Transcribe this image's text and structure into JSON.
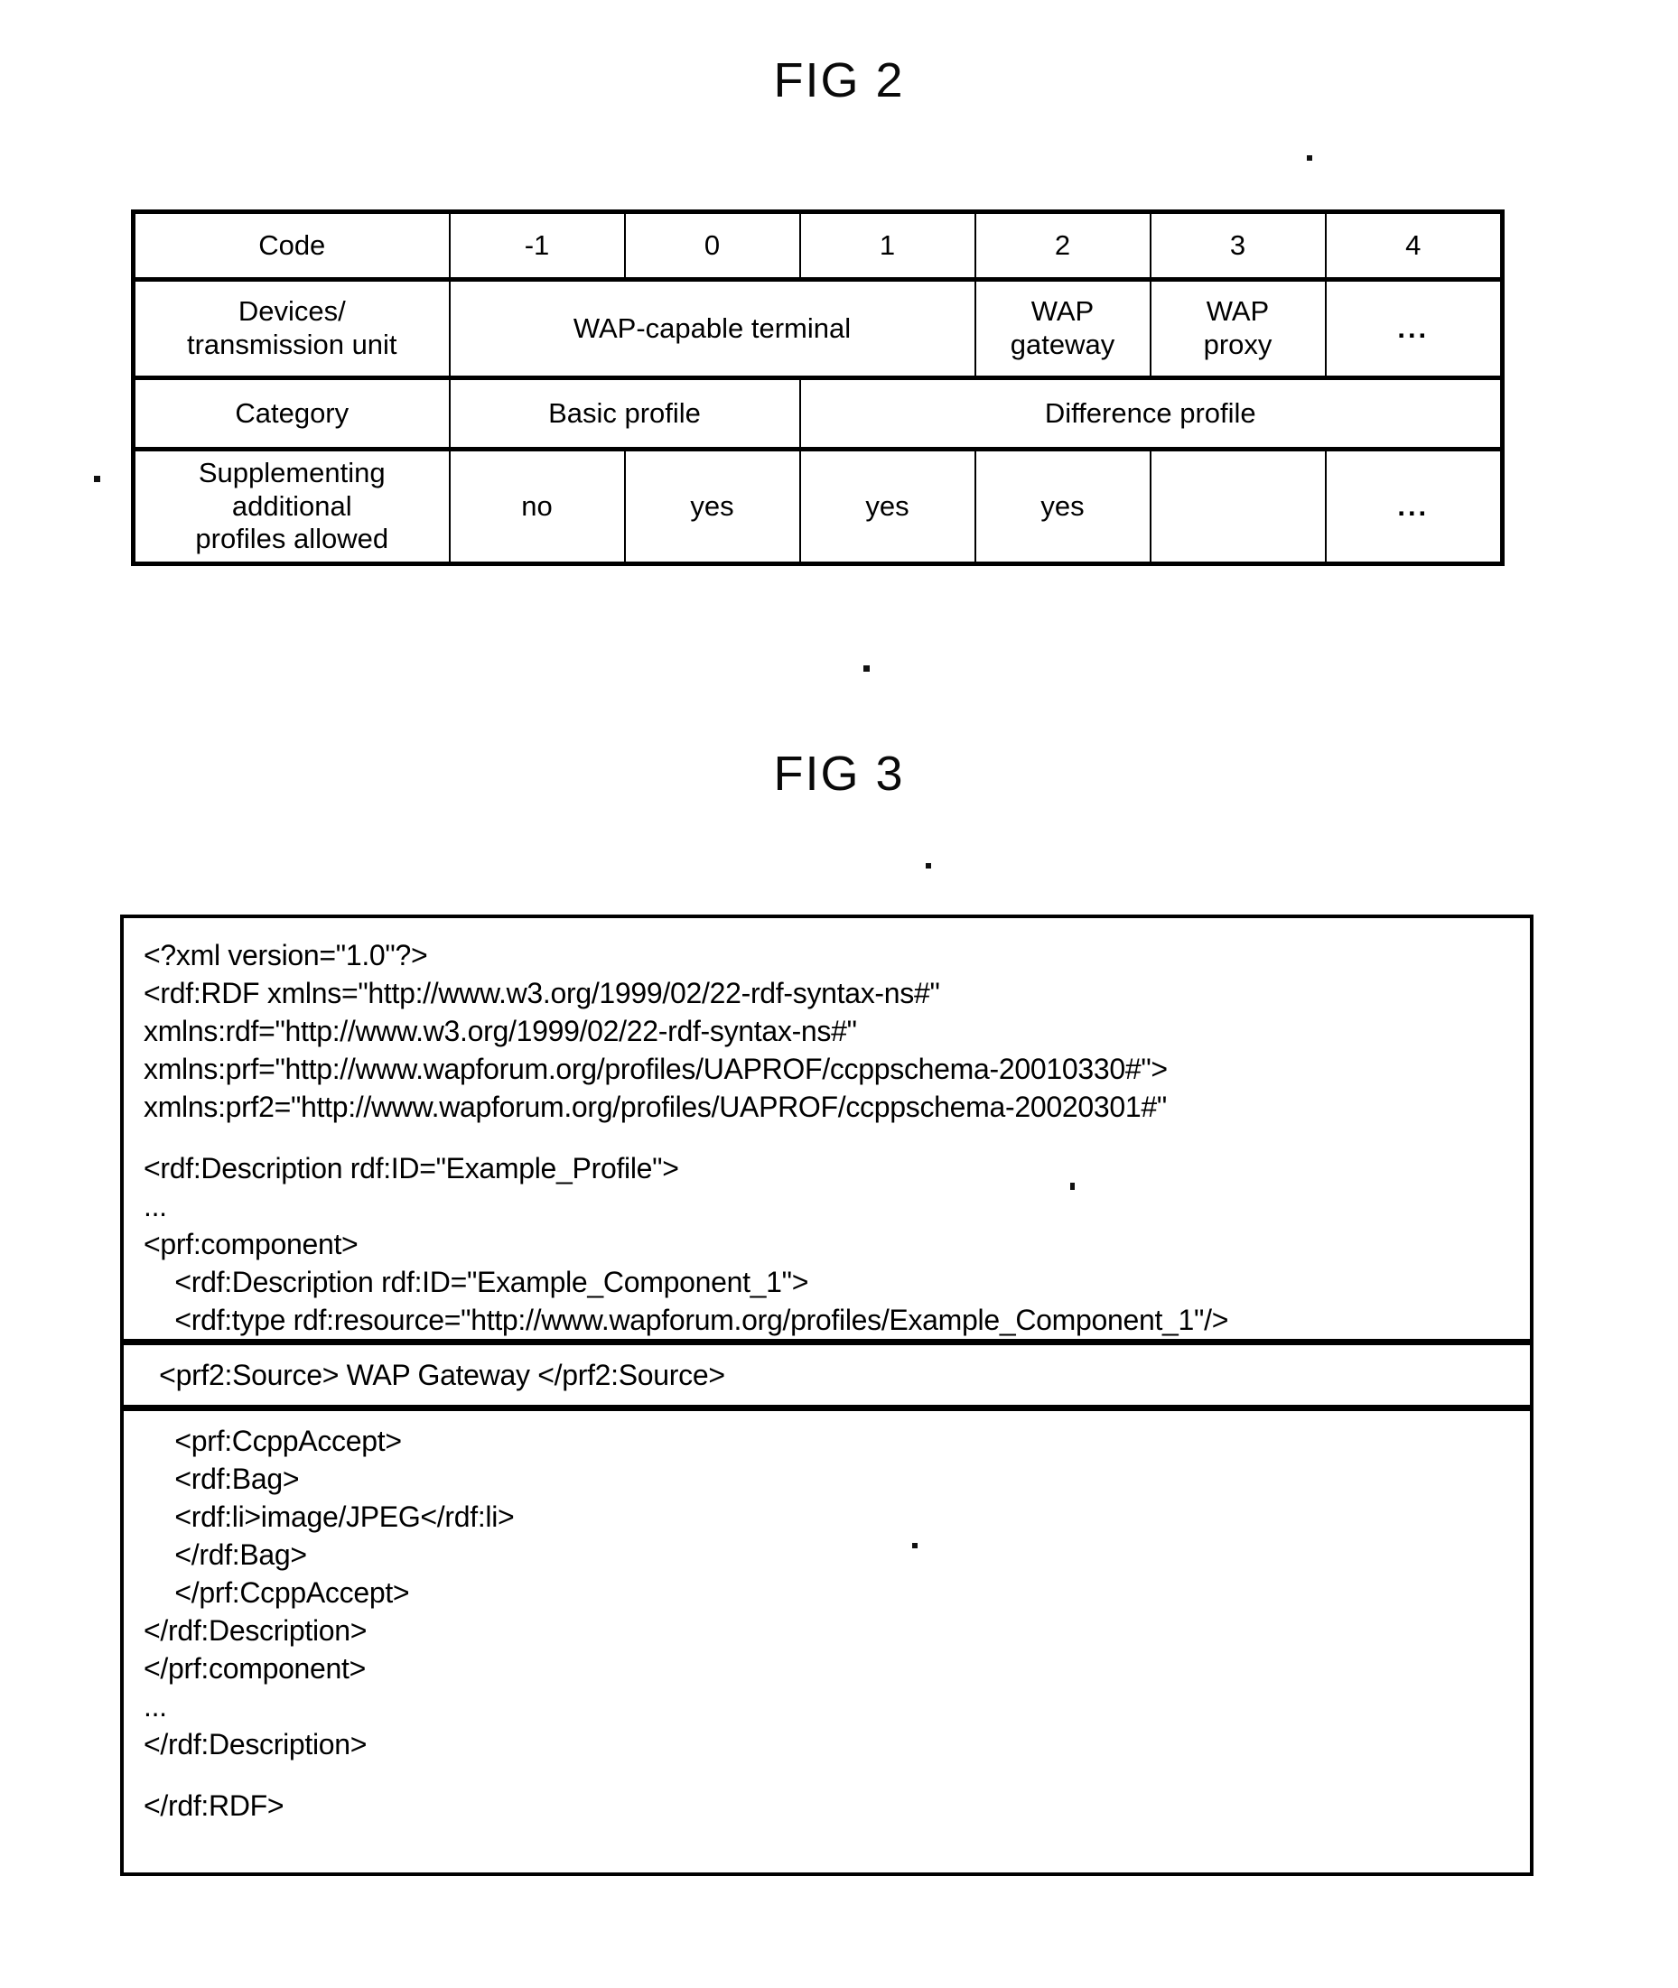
{
  "figures": {
    "fig2": {
      "title": "FIG 2",
      "table": {
        "columns": [
          "",
          "-1",
          "0",
          "1",
          "2",
          "3",
          "4"
        ],
        "rows": [
          {
            "label": "Code",
            "cells": [
              "-1",
              "0",
              "1",
              "2",
              "3",
              "4"
            ]
          },
          {
            "label": "Devices/\ntransmission unit",
            "label_line1": "Devices/",
            "label_line2": "transmission unit",
            "cells": [
              {
                "text": "WAP-capable terminal",
                "span": 3
              },
              {
                "text_line1": "WAP",
                "text_line2": "gateway",
                "span": 1
              },
              {
                "text_line1": "WAP",
                "text_line2": "proxy",
                "span": 1
              },
              {
                "text": "...",
                "span": 1
              }
            ]
          },
          {
            "label": "Category",
            "cells": [
              {
                "text": "Basic profile",
                "span": 2
              },
              {
                "text": "Difference profile",
                "span": 4
              }
            ]
          },
          {
            "label": "Supplementing additional\nprofiles allowed",
            "label_line1": "Supplementing additional",
            "label_line2": "profiles allowed",
            "cells": [
              "no",
              "yes",
              "yes",
              "yes",
              "",
              "..."
            ]
          }
        ]
      }
    },
    "fig3": {
      "title": "FIG 3",
      "code_top": [
        "<?xml version=\"1.0\"?>",
        "<rdf:RDF xmlns=\"http://www.w3.org/1999/02/22-rdf-syntax-ns#\"",
        "xmlns:rdf=\"http://www.w3.org/1999/02/22-rdf-syntax-ns#\"",
        "xmlns:prf=\"http://www.wapforum.org/profiles/UAPROF/ccppschema-20010330#\">",
        "xmlns:prf2=\"http://www.wapforum.org/profiles/UAPROF/ccppschema-20020301#\"",
        "",
        "<rdf:Description rdf:ID=\"Example_Profile\">",
        "...",
        "<prf:component>",
        "    <rdf:Description rdf:ID=\"Example_Component_1\">",
        "    <rdf:type rdf:resource=\"http://www.wapforum.org/profiles/Example_Component_1\"/>"
      ],
      "highlighted_line": "  <prf2:Source> WAP Gateway </prf2:Source>",
      "code_bottom": [
        "    <prf:CcppAccept>",
        "    <rdf:Bag>",
        "    <rdf:li>image/JPEG</rdf:li>",
        "    </rdf:Bag>",
        "    </prf:CcppAccept>",
        "</rdf:Description>",
        "</prf:component>",
        "...",
        "</rdf:Description>",
        "",
        "</rdf:RDF>"
      ]
    }
  }
}
